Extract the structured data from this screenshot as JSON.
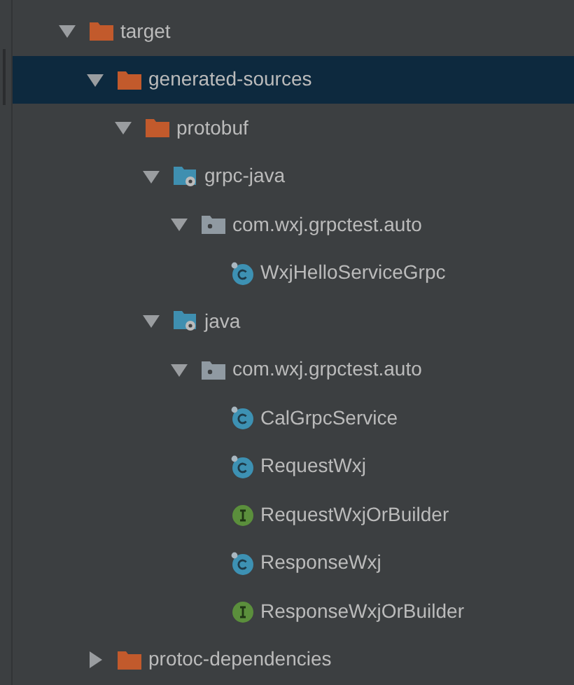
{
  "tree": [
    {
      "label": "target",
      "kind": "folder",
      "expanded": true,
      "selected": false,
      "children": [
        {
          "label": "generated-sources",
          "kind": "folder",
          "expanded": true,
          "selected": true,
          "children": [
            {
              "label": "protobuf",
              "kind": "folder",
              "expanded": true,
              "selected": false,
              "children": [
                {
                  "label": "grpc-java",
                  "kind": "source-folder",
                  "expanded": true,
                  "selected": false,
                  "children": [
                    {
                      "label": "com.wxj.grpctest.auto",
                      "kind": "package",
                      "expanded": true,
                      "selected": false,
                      "children": [
                        {
                          "label": "WxjHelloServiceGrpc",
                          "kind": "class",
                          "selected": false
                        }
                      ]
                    }
                  ]
                },
                {
                  "label": "java",
                  "kind": "source-folder",
                  "expanded": true,
                  "selected": false,
                  "children": [
                    {
                      "label": "com.wxj.grpctest.auto",
                      "kind": "package",
                      "expanded": true,
                      "selected": false,
                      "children": [
                        {
                          "label": "CalGrpcService",
                          "kind": "class",
                          "selected": false
                        },
                        {
                          "label": "RequestWxj",
                          "kind": "class",
                          "selected": false
                        },
                        {
                          "label": "RequestWxjOrBuilder",
                          "kind": "interface",
                          "selected": false
                        },
                        {
                          "label": "ResponseWxj",
                          "kind": "class",
                          "selected": false
                        },
                        {
                          "label": "ResponseWxjOrBuilder",
                          "kind": "interface",
                          "selected": false
                        }
                      ]
                    }
                  ]
                }
              ]
            }
          ]
        },
        {
          "label": "protoc-dependencies",
          "kind": "folder",
          "expanded": false,
          "selected": false
        }
      ]
    }
  ]
}
